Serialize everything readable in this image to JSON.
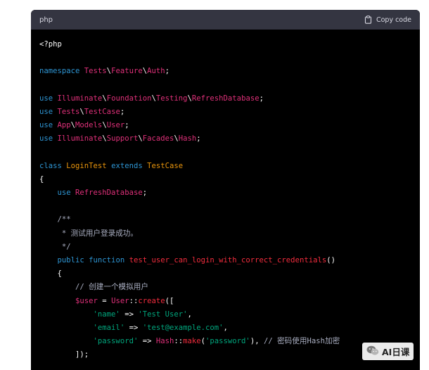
{
  "header": {
    "language": "php",
    "copy_label": "Copy code"
  },
  "code_lines": [
    [
      [
        "plain",
        "<?php"
      ]
    ],
    [],
    [
      [
        "kw",
        "namespace "
      ],
      [
        "cls",
        "Tests"
      ],
      [
        "plain",
        "\\"
      ],
      [
        "cls",
        "Feature"
      ],
      [
        "plain",
        "\\"
      ],
      [
        "cls",
        "Auth"
      ],
      [
        "plain",
        ";"
      ]
    ],
    [],
    [
      [
        "kw",
        "use "
      ],
      [
        "cls",
        "Illuminate"
      ],
      [
        "plain",
        "\\"
      ],
      [
        "cls",
        "Foundation"
      ],
      [
        "plain",
        "\\"
      ],
      [
        "cls",
        "Testing"
      ],
      [
        "plain",
        "\\"
      ],
      [
        "cls",
        "RefreshDatabase"
      ],
      [
        "plain",
        ";"
      ]
    ],
    [
      [
        "kw",
        "use "
      ],
      [
        "cls",
        "Tests"
      ],
      [
        "plain",
        "\\"
      ],
      [
        "cls",
        "TestCase"
      ],
      [
        "plain",
        ";"
      ]
    ],
    [
      [
        "kw",
        "use "
      ],
      [
        "cls",
        "App"
      ],
      [
        "plain",
        "\\"
      ],
      [
        "cls",
        "Models"
      ],
      [
        "plain",
        "\\"
      ],
      [
        "cls",
        "User"
      ],
      [
        "plain",
        ";"
      ]
    ],
    [
      [
        "kw",
        "use "
      ],
      [
        "cls",
        "Illuminate"
      ],
      [
        "plain",
        "\\"
      ],
      [
        "cls",
        "Support"
      ],
      [
        "plain",
        "\\"
      ],
      [
        "cls",
        "Facades"
      ],
      [
        "plain",
        "\\"
      ],
      [
        "cls",
        "Hash"
      ],
      [
        "plain",
        ";"
      ]
    ],
    [],
    [
      [
        "kw",
        "class "
      ],
      [
        "name-cls",
        "LoginTest "
      ],
      [
        "kw",
        "extends "
      ],
      [
        "name-cls",
        "TestCase"
      ]
    ],
    [
      [
        "plain",
        "{"
      ]
    ],
    [
      [
        "plain",
        "    "
      ],
      [
        "kw",
        "use "
      ],
      [
        "cls",
        "RefreshDatabase"
      ],
      [
        "plain",
        ";"
      ]
    ],
    [],
    [
      [
        "cmt",
        "    /**"
      ]
    ],
    [
      [
        "cmt",
        "     * 测试用户登录成功。"
      ]
    ],
    [
      [
        "cmt",
        "     */"
      ]
    ],
    [
      [
        "plain",
        "    "
      ],
      [
        "kw",
        "public "
      ],
      [
        "kw",
        "function "
      ],
      [
        "fn",
        "test_user_can_login_with_correct_credentials"
      ],
      [
        "plain",
        "()"
      ]
    ],
    [
      [
        "plain",
        "    {"
      ]
    ],
    [
      [
        "plain",
        "        "
      ],
      [
        "cmt",
        "// 创建一个模拟用户"
      ]
    ],
    [
      [
        "plain",
        "        "
      ],
      [
        "var",
        "$user"
      ],
      [
        "plain",
        " = "
      ],
      [
        "cls",
        "User"
      ],
      [
        "plain",
        "::"
      ],
      [
        "fn",
        "create"
      ],
      [
        "plain",
        "(["
      ]
    ],
    [
      [
        "plain",
        "            "
      ],
      [
        "str",
        "'name'"
      ],
      [
        "plain",
        " => "
      ],
      [
        "str",
        "'Test User'"
      ],
      [
        "plain",
        ","
      ]
    ],
    [
      [
        "plain",
        "            "
      ],
      [
        "str",
        "'email'"
      ],
      [
        "plain",
        " => "
      ],
      [
        "str",
        "'test@example.com'"
      ],
      [
        "plain",
        ","
      ]
    ],
    [
      [
        "plain",
        "            "
      ],
      [
        "str",
        "'password'"
      ],
      [
        "plain",
        " => "
      ],
      [
        "cls",
        "Hash"
      ],
      [
        "plain",
        "::"
      ],
      [
        "fn",
        "make"
      ],
      [
        "plain",
        "("
      ],
      [
        "str",
        "'password'"
      ],
      [
        "plain",
        "), "
      ],
      [
        "cmt",
        "// 密码使用Hash加密"
      ]
    ],
    [
      [
        "plain",
        "        ]);"
      ]
    ]
  ],
  "watermark": {
    "text": "AI日课"
  }
}
